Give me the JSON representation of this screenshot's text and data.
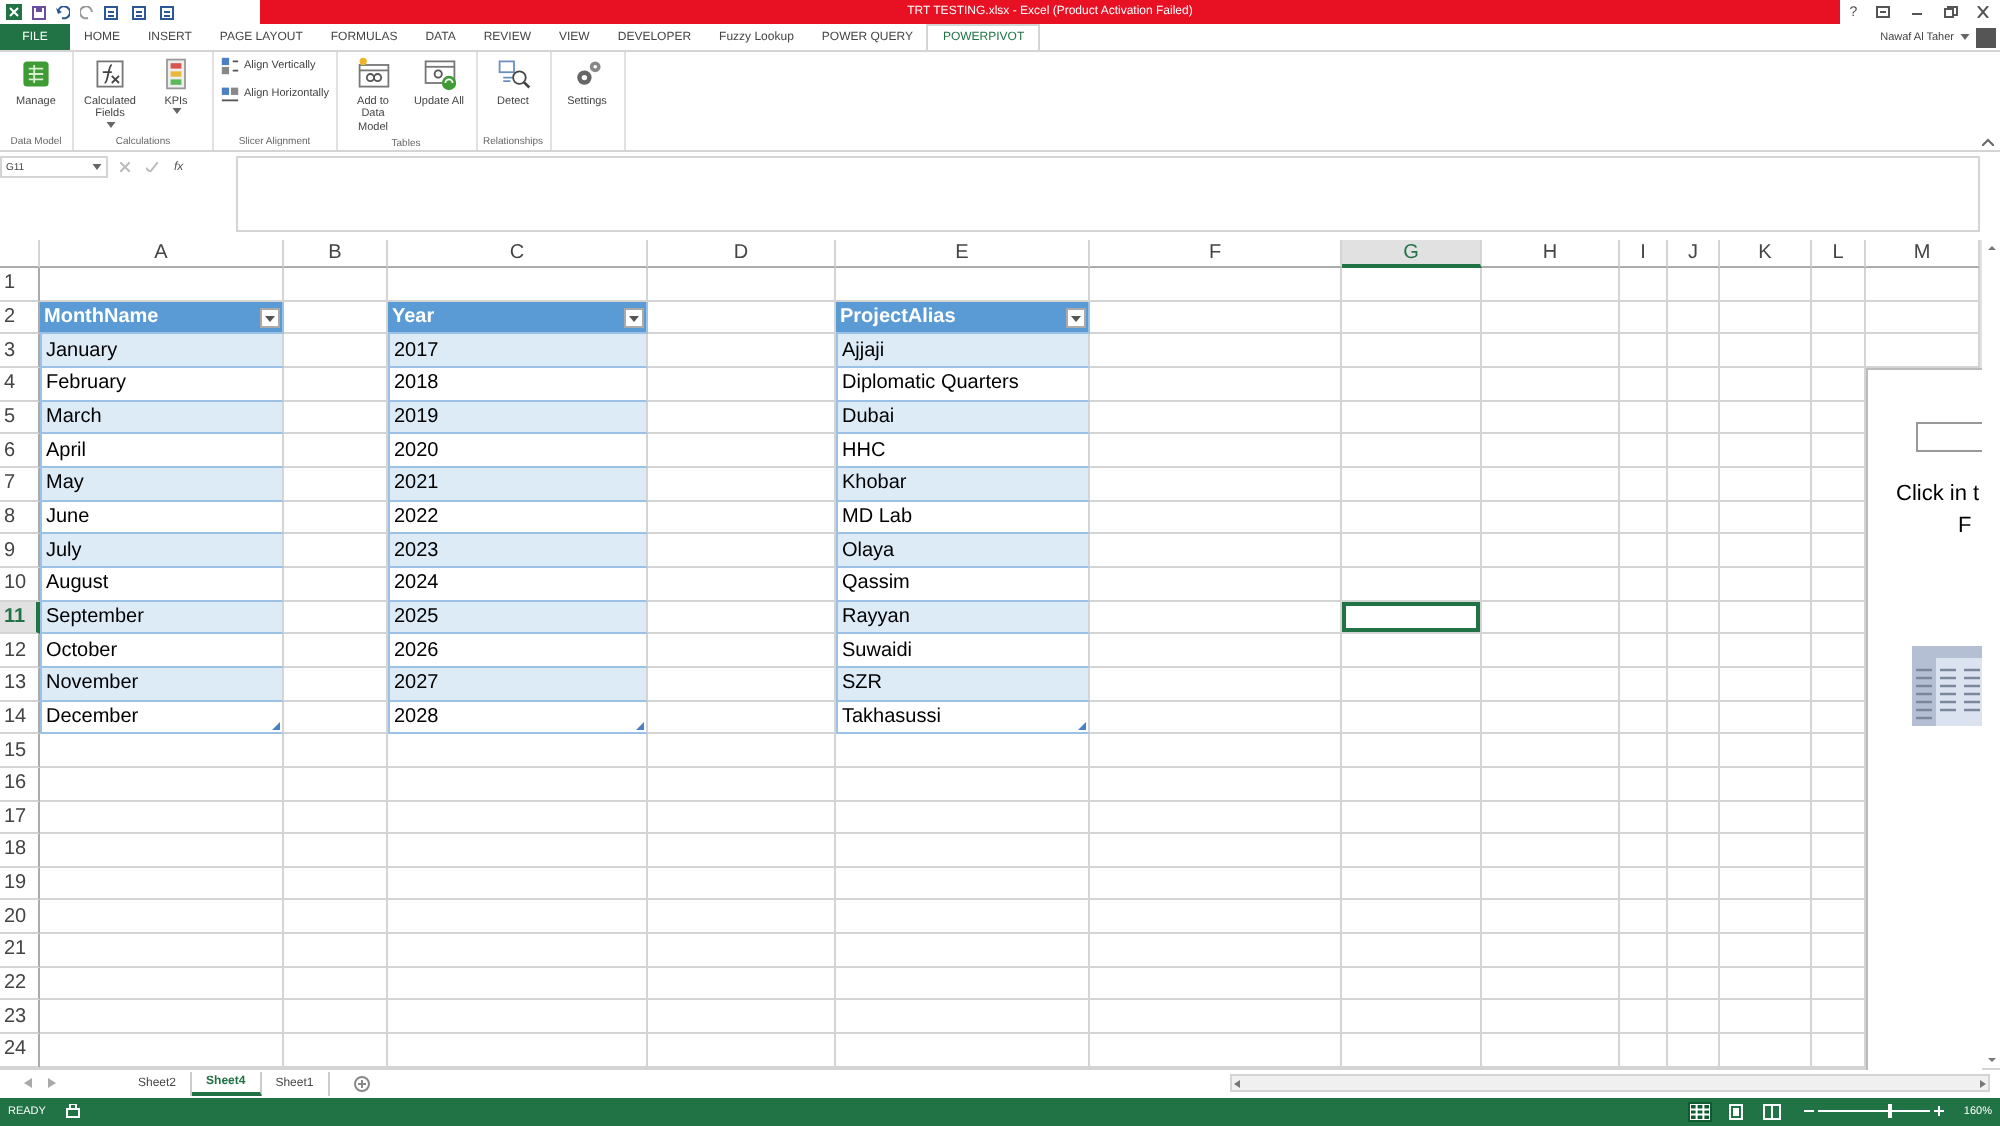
{
  "title_bar": {
    "title": "TRT TESTING.xlsx - Excel (Product Activation Failed)",
    "help": "?"
  },
  "ribbon_tabs": [
    {
      "label": "FILE",
      "kind": "file",
      "selected": false
    },
    {
      "label": "HOME",
      "kind": "tab",
      "selected": false
    },
    {
      "label": "INSERT",
      "kind": "tab",
      "selected": false
    },
    {
      "label": "PAGE LAYOUT",
      "kind": "tab",
      "selected": false
    },
    {
      "label": "FORMULAS",
      "kind": "tab",
      "selected": false
    },
    {
      "label": "DATA",
      "kind": "tab",
      "selected": false
    },
    {
      "label": "REVIEW",
      "kind": "tab",
      "selected": false
    },
    {
      "label": "VIEW",
      "kind": "tab",
      "selected": false
    },
    {
      "label": "DEVELOPER",
      "kind": "tab",
      "selected": false
    },
    {
      "label": "Fuzzy Lookup",
      "kind": "tab",
      "selected": false
    },
    {
      "label": "POWER QUERY",
      "kind": "tab",
      "selected": false
    },
    {
      "label": "POWERPIVOT",
      "kind": "tab",
      "selected": true
    }
  ],
  "user": {
    "name": "Nawaf Al Taher"
  },
  "ribbon_groups": [
    {
      "label": "Data Model",
      "buttons": [
        {
          "kind": "large",
          "label": "Manage",
          "has_menu": false
        }
      ]
    },
    {
      "label": "Calculations",
      "buttons": [
        {
          "kind": "large",
          "label": "Calculated Fields",
          "has_menu": true
        },
        {
          "kind": "large",
          "label": "KPIs",
          "has_menu": true
        }
      ]
    },
    {
      "label": "Slicer Alignment",
      "buttons": [
        {
          "kind": "small",
          "label": "Align Vertically",
          "has_menu": false
        },
        {
          "kind": "small",
          "label": "Align Horizontally",
          "has_menu": false
        }
      ]
    },
    {
      "label": "Tables",
      "buttons": [
        {
          "kind": "large",
          "label": "Add to Data Model",
          "has_menu": false
        },
        {
          "kind": "large",
          "label": "Update All",
          "has_menu": false
        }
      ]
    },
    {
      "label": "Relationships",
      "buttons": [
        {
          "kind": "large",
          "label": "Detect",
          "has_menu": false
        }
      ]
    },
    {
      "buttons": [
        {
          "kind": "large",
          "label": "Settings",
          "has_menu": false
        }
      ]
    }
  ],
  "formula_bar": {
    "name_box": "G11",
    "function_label": "fx"
  },
  "columns": [
    {
      "label": "A",
      "selected": false,
      "table": {
        "header": "MonthName",
        "values": [
          "January",
          "February",
          "March",
          "April",
          "May",
          "June",
          "July",
          "August",
          "September",
          "October",
          "November",
          "December"
        ]
      }
    },
    {
      "label": "B",
      "selected": false
    },
    {
      "label": "C",
      "selected": false,
      "table": {
        "header": "Year",
        "values": [
          "2017",
          "2018",
          "2019",
          "2020",
          "2021",
          "2022",
          "2023",
          "2024",
          "2025",
          "2026",
          "2027",
          "2028"
        ]
      }
    },
    {
      "label": "D",
      "selected": false
    },
    {
      "label": "E",
      "selected": false,
      "table": {
        "header": "ProjectAlias",
        "values": [
          "Ajjaji",
          "Diplomatic Quarters",
          "Dubai",
          "HHC",
          "Khobar",
          "MD Lab",
          "Olaya",
          "Qassim",
          "Rayyan",
          "Suwaidi",
          "SZR",
          "Takhasussi"
        ]
      }
    },
    {
      "label": "F",
      "selected": false
    },
    {
      "label": "G",
      "selected": true
    },
    {
      "label": "H",
      "selected": false
    },
    {
      "label": "I",
      "selected": false
    },
    {
      "label": "J",
      "selected": false
    },
    {
      "label": "K",
      "selected": false
    },
    {
      "label": "L",
      "selected": false
    },
    {
      "label": "M",
      "selected": false
    }
  ],
  "rows": [
    {
      "label": "1",
      "selected": false
    },
    {
      "label": "2",
      "selected": false
    },
    {
      "label": "3",
      "selected": false
    },
    {
      "label": "4",
      "selected": false
    },
    {
      "label": "5",
      "selected": false
    },
    {
      "label": "6",
      "selected": false
    },
    {
      "label": "7",
      "selected": false
    },
    {
      "label": "8",
      "selected": false
    },
    {
      "label": "9",
      "selected": false
    },
    {
      "label": "10",
      "selected": false
    },
    {
      "label": "11",
      "selected": true
    },
    {
      "label": "12",
      "selected": false
    },
    {
      "label": "13",
      "selected": false
    },
    {
      "label": "14",
      "selected": false
    },
    {
      "label": "15",
      "selected": false
    },
    {
      "label": "16",
      "selected": false
    },
    {
      "label": "17",
      "selected": false
    },
    {
      "label": "18",
      "selected": false
    },
    {
      "label": "19",
      "selected": false
    },
    {
      "label": "20",
      "selected": false
    },
    {
      "label": "21",
      "selected": false
    },
    {
      "label": "22",
      "selected": false
    },
    {
      "label": "23",
      "selected": false
    },
    {
      "label": "24",
      "selected": false
    }
  ],
  "pivot_placeholder": {
    "lines": [
      "Click in t",
      "F"
    ]
  },
  "sheet_tabs": [
    {
      "label": "Sheet2",
      "selected": false
    },
    {
      "label": "Sheet4",
      "selected": true
    },
    {
      "label": "Sheet1",
      "selected": false
    }
  ],
  "status_bar": {
    "mode": "READY",
    "views": [
      {
        "kind": "normal",
        "selected": true
      },
      {
        "kind": "page-layout",
        "selected": false
      },
      {
        "kind": "page-break",
        "selected": false
      }
    ],
    "zoom": {
      "level": 0.62,
      "label": "160%"
    }
  }
}
